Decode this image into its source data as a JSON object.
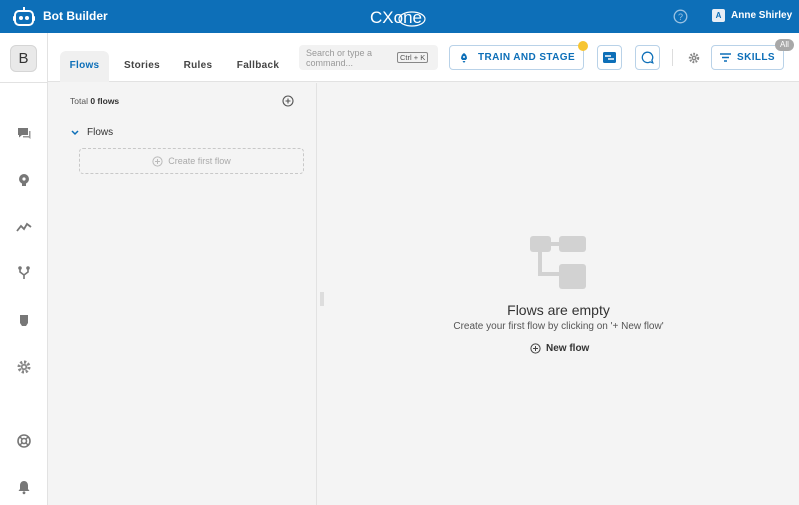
{
  "header": {
    "app_title": "Bot Builder",
    "brand": "CXone",
    "user_initial": "A",
    "user_name": "Anne Shirley"
  },
  "rail": {
    "bot_initial": "B",
    "icons": [
      "chat-icon",
      "bulb-icon",
      "analytics-icon",
      "branch-icon",
      "shield-icon",
      "settings-icon",
      "support-icon",
      "bell-icon"
    ]
  },
  "tabs": [
    {
      "label": "Flows",
      "active": true
    },
    {
      "label": "Stories",
      "active": false
    },
    {
      "label": "Rules",
      "active": false
    },
    {
      "label": "Fallback",
      "active": false
    }
  ],
  "search": {
    "placeholder": "Search or type a command...",
    "shortcut": "Ctrl + K"
  },
  "toolbar": {
    "train_label": "TRAIN AND STAGE",
    "skills_label": "SKILLS",
    "skills_badge": "All"
  },
  "flows": {
    "total_prefix": "Total",
    "total_count": "0 flows",
    "group_label": "Flows",
    "create_first_label": "Create first flow"
  },
  "empty": {
    "title": "Flows are empty",
    "subtitle": "Create your first flow by clicking on '+ New flow'",
    "new_flow_label": "New flow"
  },
  "colors": {
    "brand_blue": "#0d6fb8",
    "notification": "#f7c531"
  }
}
